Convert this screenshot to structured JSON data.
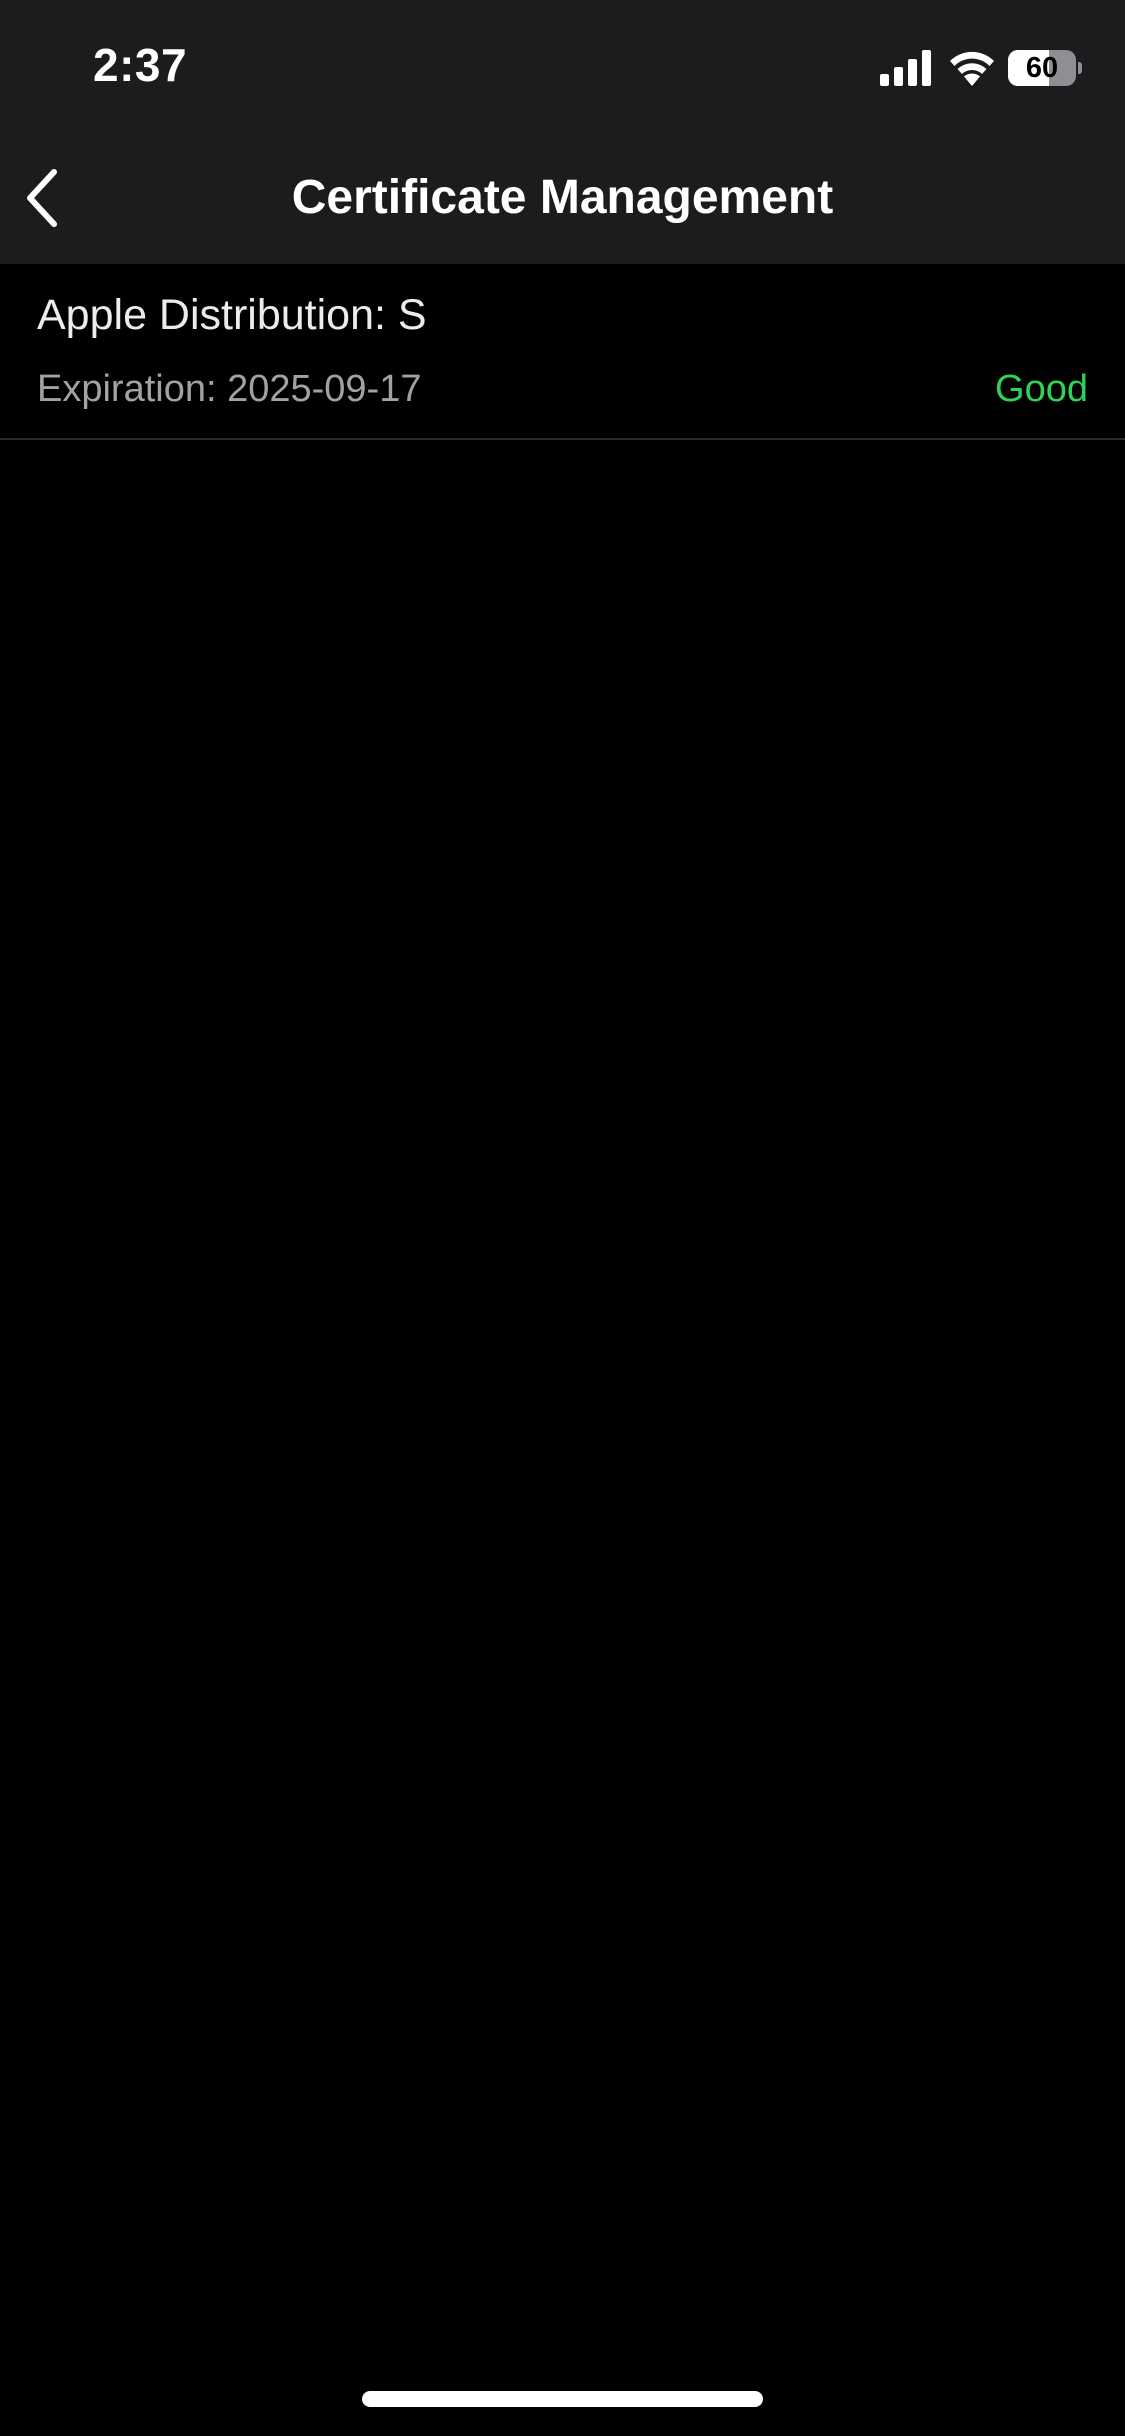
{
  "status_bar": {
    "time": "2:37",
    "battery_level": 60,
    "battery_text": "60",
    "icons": [
      "cellular-signal-icon",
      "wifi-icon",
      "battery-icon"
    ]
  },
  "nav": {
    "back_icon": "chevron-left-icon",
    "title": "Certificate Management"
  },
  "certificates": [
    {
      "name": "Apple Distribution: S",
      "expiration": "Expiration: 2025-09-17",
      "status": "Good",
      "status_color": "#30d158"
    }
  ],
  "colors": {
    "background": "#000000",
    "bar_background": "#1c1c1e",
    "status_good": "#30d158"
  }
}
